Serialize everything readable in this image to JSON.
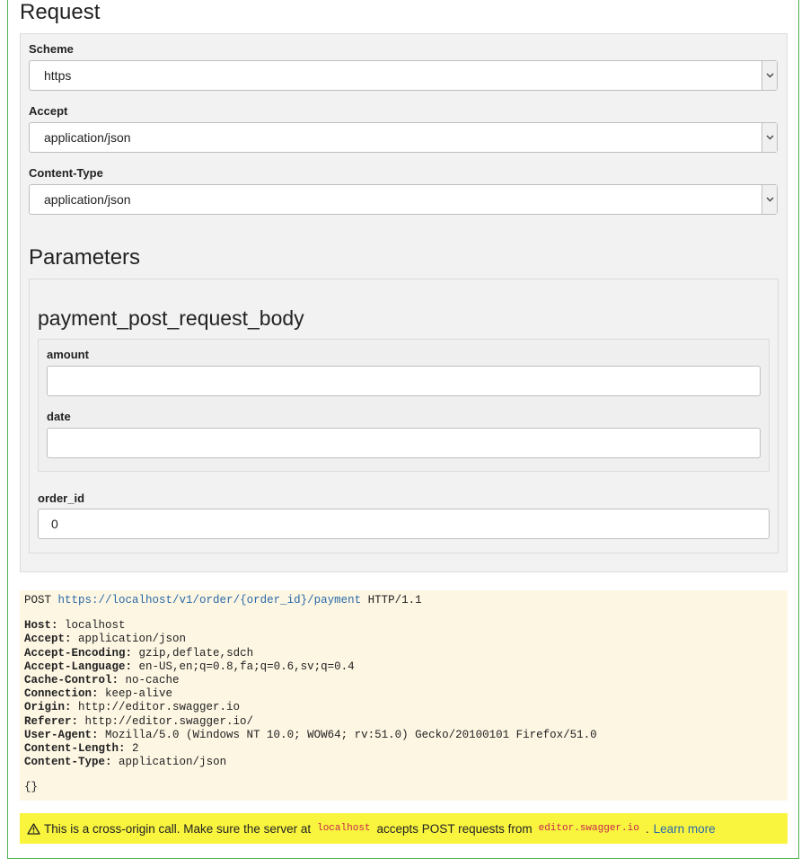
{
  "request": {
    "title": "Request",
    "scheme": {
      "label": "Scheme",
      "value": "https"
    },
    "accept": {
      "label": "Accept",
      "value": "application/json"
    },
    "content_type": {
      "label": "Content-Type",
      "value": "application/json"
    }
  },
  "parameters": {
    "title": "Parameters",
    "body_title": "payment_post_request_body",
    "amount": {
      "label": "amount",
      "value": ""
    },
    "date": {
      "label": "date",
      "value": ""
    },
    "order_id": {
      "label": "order_id",
      "value": "0"
    }
  },
  "http_preview": {
    "method": "POST",
    "url": "https://localhost/v1/order/{order_id}/payment",
    "protocol": "HTTP/1.1",
    "headers": [
      {
        "name": "Host:",
        "value": "localhost"
      },
      {
        "name": "Accept:",
        "value": "application/json"
      },
      {
        "name": "Accept-Encoding:",
        "value": "gzip,deflate,sdch"
      },
      {
        "name": "Accept-Language:",
        "value": "en-US,en;q=0.8,fa;q=0.6,sv;q=0.4"
      },
      {
        "name": "Cache-Control:",
        "value": "no-cache"
      },
      {
        "name": "Connection:",
        "value": "keep-alive"
      },
      {
        "name": "Origin:",
        "value": "http://editor.swagger.io"
      },
      {
        "name": "Referer:",
        "value": "http://editor.swagger.io/"
      },
      {
        "name": "User-Agent:",
        "value": "Mozilla/5.0 (Windows NT 10.0; WOW64; rv:51.0) Gecko/20100101 Firefox/51.0"
      },
      {
        "name": "Content-Length:",
        "value": "2"
      },
      {
        "name": "Content-Type:",
        "value": "application/json"
      }
    ],
    "body": "{}"
  },
  "warning": {
    "text_1": "This is a cross-origin call. Make sure the server at",
    "host": "localhost",
    "text_2": "accepts POST requests from",
    "origin": "editor.swagger.io",
    "text_3": ".",
    "link": "Learn more"
  },
  "colors": {
    "accent_border": "#4caf50",
    "code_background": "#fdf6e3",
    "warning_background": "#f9f53f",
    "link": "#2a6aa8",
    "inline_code": "#c7254e"
  },
  "icons": {
    "select_arrow": "chevron-down-icon",
    "warning": "warning-triangle-icon"
  }
}
